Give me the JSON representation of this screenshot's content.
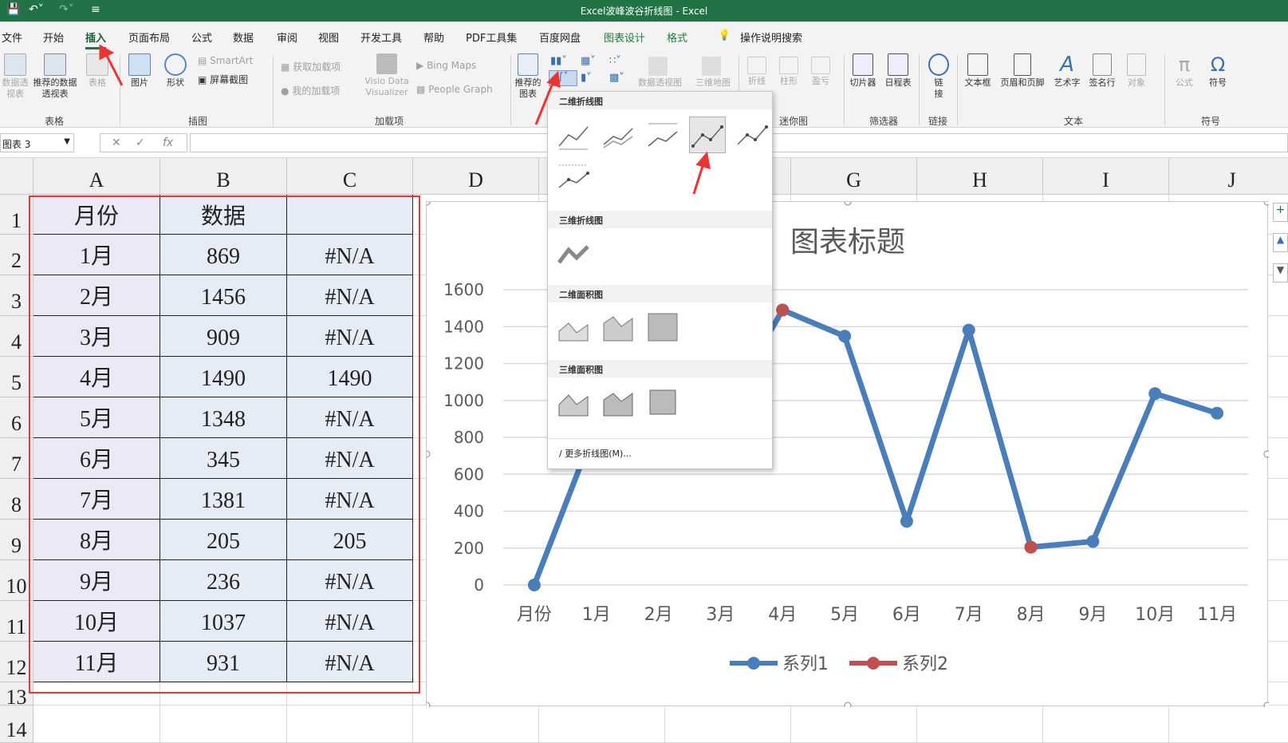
{
  "window": {
    "title": "Excel波峰波谷折线图  -  Excel"
  },
  "menu_tabs": [
    "文件",
    "开始",
    "插入",
    "页面布局",
    "公式",
    "数据",
    "审阅",
    "视图",
    "开发工具",
    "帮助",
    "PDF工具集",
    "百度网盘",
    "图表设计",
    "格式",
    "操作说明搜索"
  ],
  "ribbon": {
    "groups": [
      "表格",
      "插图",
      "加载项",
      "迷你图",
      "筛选器",
      "链接",
      "文本",
      "符号"
    ],
    "btn_pivot": "数据透视表",
    "btn_rec_pivot": "推荐的数据透视表",
    "btn_table": "表格",
    "btn_picture": "图片",
    "btn_shapes": "形状",
    "btn_smartart": "SmartArt",
    "btn_screenshot": "屏幕截图",
    "btn_get_addins": "获取加载项",
    "btn_my_addins": "我的加载项",
    "btn_visio": "Visio Data Visualizer",
    "btn_bing": "Bing Maps",
    "btn_people": "People Graph",
    "btn_rec_chart": "推荐的图表",
    "btn_pivot_chart": "数据透视图",
    "btn_3dmap": "三维地图",
    "btn_spark_line": "折线",
    "btn_spark_col": "柱形",
    "btn_spark_wl": "盈亏",
    "btn_slicer": "切片器",
    "btn_timeline": "日程表",
    "btn_link": "链接",
    "btn_textbox": "文本框",
    "btn_header": "页眉和页脚",
    "btn_wordart": "艺术字",
    "btn_sigline": "签名行",
    "btn_object": "对象",
    "btn_equation": "公式",
    "btn_symbol": "符号"
  },
  "formula_bar": {
    "name_box": "图表 3",
    "fx": "fx",
    "content": ""
  },
  "columns": [
    "A",
    "B",
    "C",
    "D",
    "E",
    "F",
    "G",
    "H",
    "I",
    "J"
  ],
  "rows": [
    "1",
    "2",
    "3",
    "4",
    "5",
    "6",
    "7",
    "8",
    "9",
    "10",
    "11",
    "12",
    "13",
    "14"
  ],
  "table": {
    "headers": [
      "月份",
      "数据",
      ""
    ],
    "rows": [
      [
        "1月",
        "869",
        "#N/A"
      ],
      [
        "2月",
        "1456",
        "#N/A"
      ],
      [
        "3月",
        "909",
        "#N/A"
      ],
      [
        "4月",
        "1490",
        "1490"
      ],
      [
        "5月",
        "1348",
        "#N/A"
      ],
      [
        "6月",
        "345",
        "#N/A"
      ],
      [
        "7月",
        "1381",
        "#N/A"
      ],
      [
        "8月",
        "205",
        "205"
      ],
      [
        "9月",
        "236",
        "#N/A"
      ],
      [
        "10月",
        "1037",
        "#N/A"
      ],
      [
        "11月",
        "931",
        "#N/A"
      ]
    ]
  },
  "dropdown": {
    "sections": [
      "二维折线图",
      "三维折线图",
      "二维面积图",
      "三维面积图"
    ],
    "more": "更多折线图(M)..."
  },
  "chart_data": {
    "type": "line",
    "title": "图表标题",
    "categories": [
      "月份",
      "1月",
      "2月",
      "3月",
      "4月",
      "5月",
      "6月",
      "7月",
      "8月",
      "9月",
      "10月",
      "11月"
    ],
    "ylim": [
      0,
      1600
    ],
    "yticks": [
      "0",
      "200",
      "400",
      "600",
      "800",
      "1000",
      "1200",
      "1400",
      "1600"
    ],
    "series": [
      {
        "name": "系列1",
        "color": "#4a7ebb",
        "values": [
          0,
          869,
          1456,
          909,
          1490,
          1348,
          345,
          1381,
          205,
          236,
          1037,
          931
        ]
      },
      {
        "name": "系列2",
        "color": "#c0504d",
        "values": [
          null,
          null,
          null,
          null,
          1490,
          null,
          null,
          null,
          205,
          null,
          null,
          null
        ]
      }
    ],
    "legend": "bottom",
    "grid": true
  }
}
